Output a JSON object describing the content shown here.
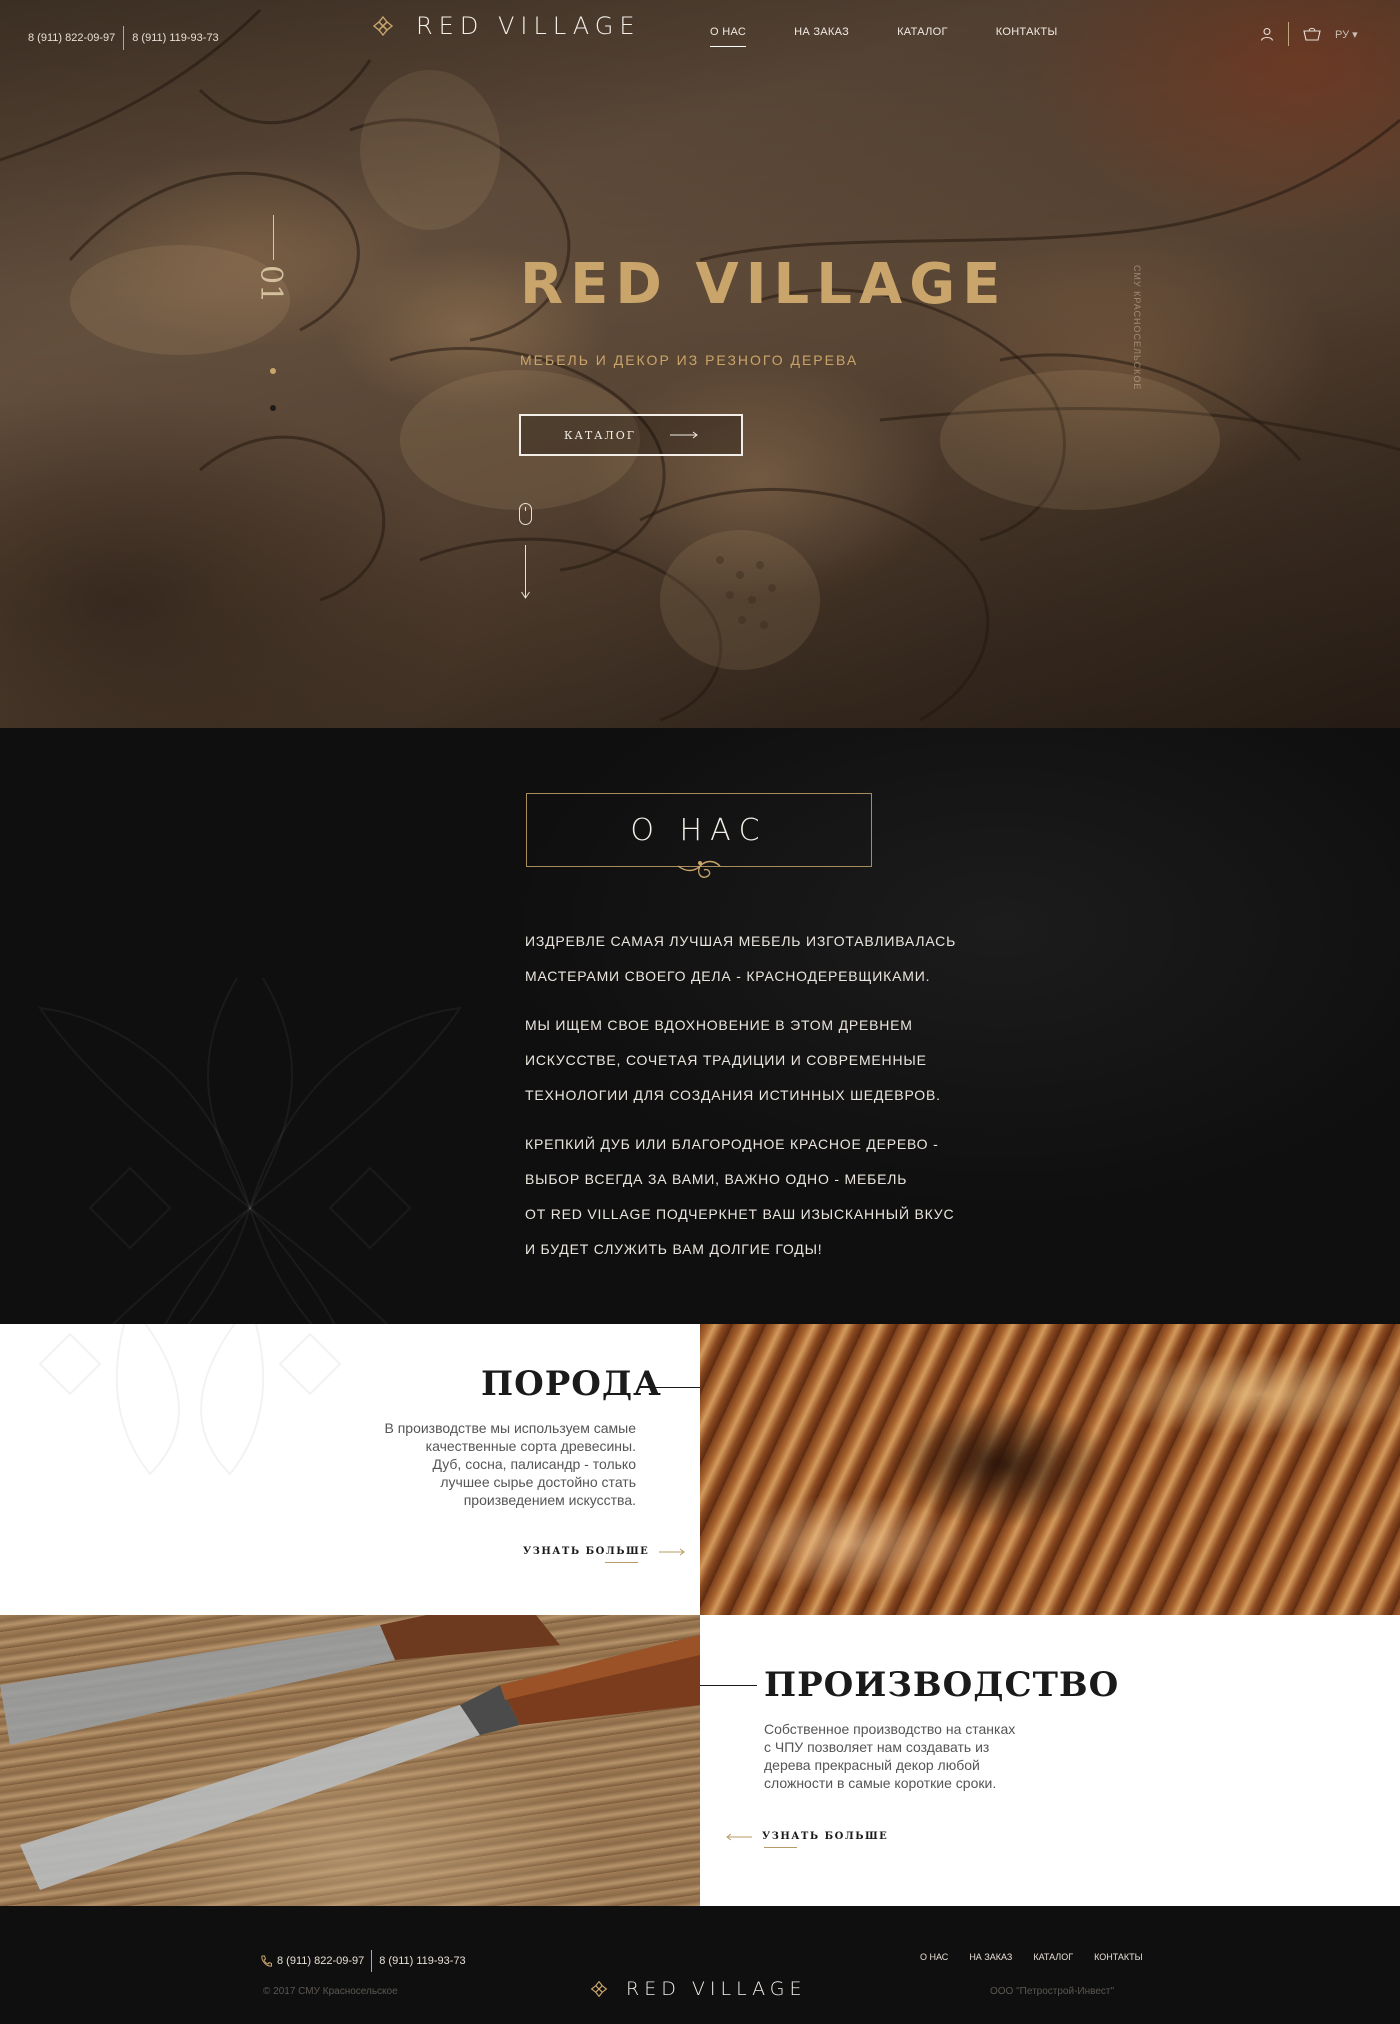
{
  "header": {
    "phones": [
      "8 (911) 822-09-97",
      "8 (911) 119-93-73"
    ],
    "brand": "RED VILLAGE",
    "nav": [
      "О НАС",
      "НА ЗАКАЗ",
      "КАТАЛОГ",
      "КОНТАКТЫ"
    ],
    "active_nav": "О НАС",
    "lang": "РУ ▾"
  },
  "hero": {
    "slide_number": "01",
    "title": "RED VILLAGE",
    "subtitle": "МЕБЕЛЬ И ДЕКОР ИЗ РЕЗНОГО ДЕРЕВА",
    "button_label": "КАТАЛОГ",
    "side_caption": "СМУ КРАСНОСЕЛЬСКОЕ"
  },
  "about": {
    "title": "О НАС",
    "paragraphs": [
      [
        "ИЗДРЕВЛЕ САМАЯ ЛУЧШАЯ МЕБЕЛЬ ИЗГОТАВЛИВАЛАСЬ",
        "МАСТЕРАМИ СВОЕГО ДЕЛА - КРАСНОДЕРЕВЩИКАМИ."
      ],
      [
        "МЫ ИЩЕМ СВОЕ ВДОХНОВЕНИЕ В ЭТОМ ДРЕВНЕМ",
        "ИСКУССТВЕ, СОЧЕТАЯ ТРАДИЦИИ И СОВРЕМЕННЫЕ",
        "ТЕХНОЛОГИИ ДЛЯ СОЗДАНИЯ ИСТИННЫХ ШЕДЕВРОВ."
      ],
      [
        "КРЕПКИЙ ДУБ ИЛИ БЛАГОРОДНОЕ КРАСНОЕ ДЕРЕВО -",
        "ВЫБОР ВСЕГДА ЗА ВАМИ, ВАЖНО ОДНО - МЕБЕЛЬ",
        "ОТ RED VILLAGE ПОДЧЕРКНЕТ ВАШ ИЗЫСКАННЫЙ ВКУС",
        "И БУДЕТ СЛУЖИТЬ ВАМ ДОЛГИЕ ГОДЫ!"
      ]
    ]
  },
  "features": [
    {
      "title": "ПОРОДА",
      "text": [
        "В производстве мы используем самые",
        "качественные сорта древесины.",
        "Дуб, сосна, палисандр - только",
        "лучшее сырье достойно стать",
        "произведением искусства."
      ],
      "link": "УЗНАТЬ БОЛЬШЕ"
    },
    {
      "title": "ПРОИЗВОДСТВО",
      "text": [
        "Собственное производство на станках",
        "с ЧПУ позволяет нам создавать из",
        "дерева прекрасный декор любой",
        "сложности в самые короткие сроки."
      ],
      "link": "УЗНАТЬ БОЛЬШЕ"
    }
  ],
  "footer": {
    "phones": [
      "8 (911) 822-09-97",
      "8 (911) 119-93-73"
    ],
    "nav": [
      "О НАС",
      "НА ЗАКАЗ",
      "КАТАЛОГ",
      "КОНТАКТЫ"
    ],
    "copyright": "© 2017 СМУ Красносельское",
    "brand": "RED VILLAGE",
    "company": "ООО \"Петрострой-Инвест\""
  },
  "colors": {
    "gold": "#c9a56b",
    "dark": "#0f0f0f",
    "white": "#ffffff"
  }
}
